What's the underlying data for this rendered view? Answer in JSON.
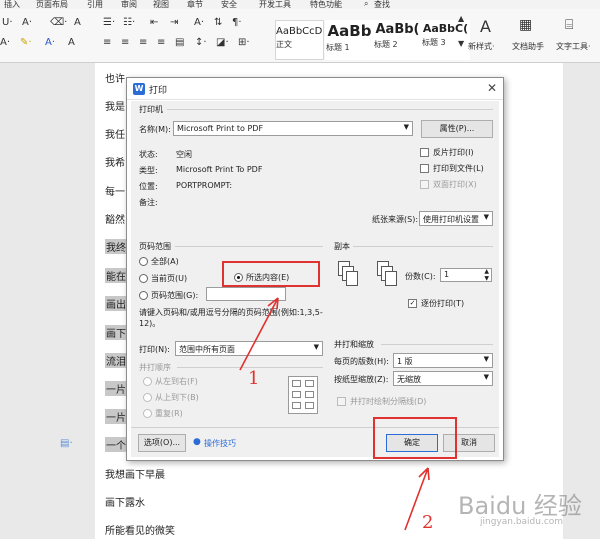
{
  "menubar": [
    "插入",
    "页面布局",
    "引用",
    "审阅",
    "视图",
    "章节",
    "安全",
    "开发工具",
    "特色功能",
    "查找"
  ],
  "ribbon": {
    "styles": [
      {
        "sample": "AaBbCcDd",
        "label": "正文"
      },
      {
        "sample": "AaBb",
        "label": "标题 1"
      },
      {
        "sample": "AaBb(",
        "label": "标题 2"
      },
      {
        "sample": "AaBbC(",
        "label": "标题 3"
      }
    ],
    "new_style": "新样式·",
    "doc_helper": "文档助手",
    "text_tools": "文字工具·"
  },
  "document": {
    "lines": [
      "也许",
      "我是",
      "我任",
      "我希",
      "每一",
      "豁然",
      "我终",
      "能在",
      "画出",
      "画下",
      "流泪",
      "一片",
      "一片",
      "一个",
      "我想画下早晨",
      "画下露水",
      "所能看见的微笑"
    ]
  },
  "dialog": {
    "title": "打印",
    "printer": {
      "group": "打印机",
      "name_label": "名称(M):",
      "name_value": "Microsoft Print to PDF",
      "properties": "属性(P)...",
      "status_label": "状态:",
      "status_value": "空闲",
      "type_label": "类型:",
      "type_value": "Microsoft Print To PDF",
      "location_label": "位置:",
      "location_value": "PORTPROMPT:",
      "comment_label": "备注:",
      "reverse": "反片打印(I)",
      "to_file": "打印到文件(L)",
      "duplex": "双面打印(X)",
      "source_label": "纸张来源(S):",
      "source_value": "使用打印机设置"
    },
    "range": {
      "group": "页码范围",
      "all": "全部(A)",
      "current": "当前页(U)",
      "selection": "所选内容(E)",
      "pages": "页码范围(G):",
      "hint": "请键入页码和/或用逗号分隔的页码范围(例如:1,3,5-12)。",
      "print_label": "打印(N):",
      "print_value": "范围中所有页面",
      "order_group": "并打顺序",
      "left_right": "从左到右(F)",
      "top_bottom": "从上到下(B)",
      "repeat": "重复(R)"
    },
    "copies": {
      "group": "副本",
      "label": "份数(C):",
      "value": "1",
      "collate": "逐份打印(T)"
    },
    "zoom": {
      "group": "并打和缩放",
      "per_sheet_label": "每页的版数(H):",
      "per_sheet_value": "1 版",
      "scale_label": "按纸型缩放(Z):",
      "scale_value": "无缩放",
      "lines": "并打时绘制分隔线(D)"
    },
    "options": "选项(O)...",
    "tips": "操作技巧",
    "ok": "确定",
    "cancel": "取消"
  },
  "annotations": {
    "one": "1",
    "two": "2"
  },
  "watermark": {
    "text": "Baidu 经验",
    "url": "jingyan.baidu.com"
  },
  "colors": {
    "accent": "#2b6cd6",
    "annotation": "#e0322f"
  }
}
